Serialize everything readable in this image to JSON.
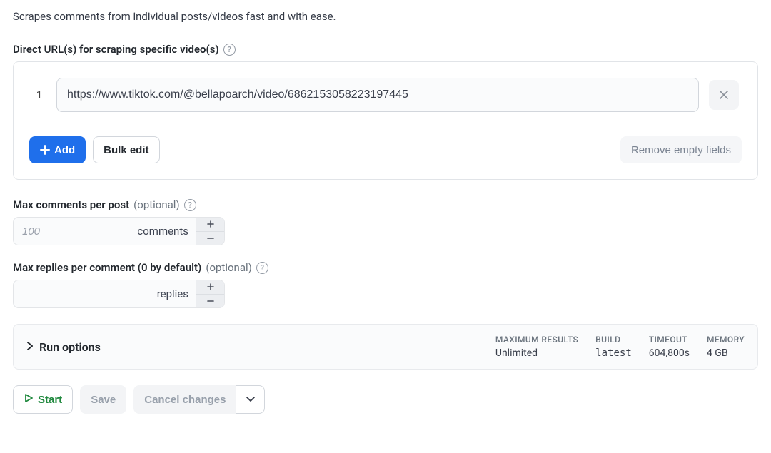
{
  "description": "Scrapes comments from individual posts/videos fast and with ease.",
  "urls_section": {
    "label": "Direct URL(s) for scraping specific video(s)",
    "row_index": "1",
    "url_value": "https://www.tiktok.com/@bellapoarch/video/6862153058223197445",
    "add_label": "Add",
    "bulk_edit_label": "Bulk edit",
    "remove_empty_label": "Remove empty fields"
  },
  "max_comments": {
    "label": "Max comments per post",
    "optional": "(optional)",
    "placeholder": "100",
    "unit": "comments"
  },
  "max_replies": {
    "label": "Max replies per comment (0 by default)",
    "optional": "(optional)",
    "placeholder": "",
    "unit": "replies"
  },
  "run_options": {
    "title": "Run options",
    "stats": {
      "max_results_label": "MAXIMUM RESULTS",
      "max_results_value": "Unlimited",
      "build_label": "BUILD",
      "build_value": "latest",
      "timeout_label": "TIMEOUT",
      "timeout_value": "604,800s",
      "memory_label": "MEMORY",
      "memory_value": "4 GB"
    }
  },
  "actions": {
    "start": "Start",
    "save": "Save",
    "cancel": "Cancel changes"
  }
}
